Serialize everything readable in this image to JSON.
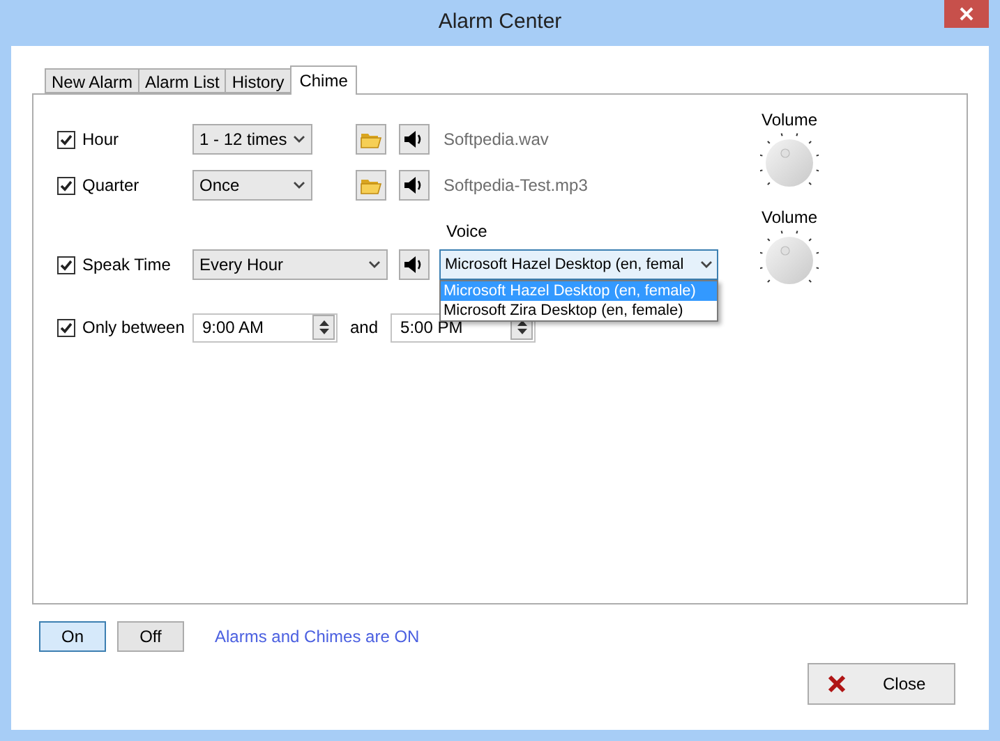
{
  "window": {
    "title": "Alarm Center"
  },
  "tabs": [
    {
      "label": "New Alarm",
      "selected": false
    },
    {
      "label": "Alarm List",
      "selected": false
    },
    {
      "label": "History",
      "selected": false
    },
    {
      "label": "Chime",
      "selected": true
    }
  ],
  "chime_rows": [
    {
      "kind": "sound",
      "label": "Hour",
      "checked": true,
      "frequency": "1 - 12 times",
      "file": "Softpedia.wav"
    },
    {
      "kind": "sound",
      "label": "Quarter",
      "checked": true,
      "frequency": "Once",
      "file": "Softpedia-Test.mp3"
    },
    {
      "kind": "speak",
      "label": "Speak Time",
      "checked": true,
      "frequency": "Every Hour",
      "voice_label": "Voice",
      "voice": "Microsoft Hazel Desktop (en, femal",
      "voice_options": [
        {
          "label": "Microsoft Hazel Desktop (en, female)",
          "selected": true
        },
        {
          "label": "Microsoft Zira Desktop (en, female)",
          "selected": false
        }
      ]
    }
  ],
  "only_between": {
    "label": "Only between",
    "checked": true,
    "from": "9:00 AM",
    "joiner": "and",
    "to": "5:00 PM"
  },
  "volume_knobs": [
    {
      "label": "Volume"
    },
    {
      "label": "Volume"
    }
  ],
  "power_buttons": [
    {
      "label": "On",
      "selected": true
    },
    {
      "label": "Off",
      "selected": false
    }
  ],
  "status": "Alarms and Chimes are ON",
  "close_button": "Close"
}
